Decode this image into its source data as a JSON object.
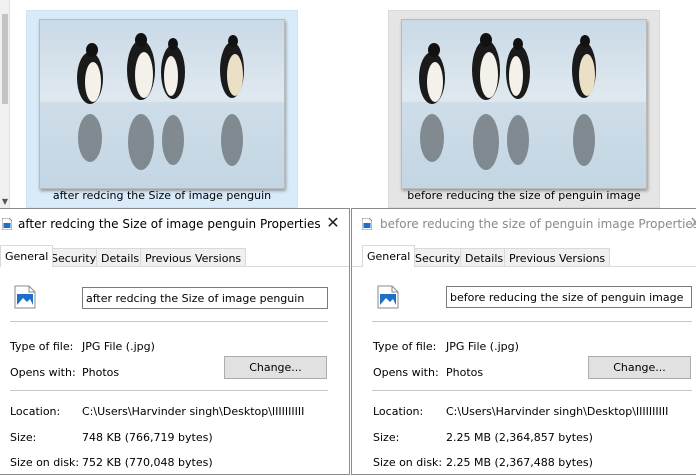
{
  "explorer": {
    "items": [
      {
        "caption": "after redcing the Size of image penguin"
      },
      {
        "caption": "before reducing the size of penguin image"
      }
    ]
  },
  "dialogs": [
    {
      "title": "after redcing the Size of image penguin Properties",
      "tabs": [
        "General",
        "Security",
        "Details",
        "Previous Versions"
      ],
      "file_name": "after redcing the Size of image penguin",
      "labels": {
        "type": "Type of file:",
        "opens": "Opens with:",
        "location": "Location:",
        "size": "Size:",
        "size_on_disk": "Size on disk:"
      },
      "type_of_file": "JPG File (.jpg)",
      "opens_with": "Photos",
      "change_label": "Change...",
      "location": "C:\\Users\\Harvinder singh\\Desktop\\IIIIIIIIII",
      "size": "748 KB (766,719 bytes)",
      "size_on_disk": "752 KB (770,048 bytes)"
    },
    {
      "title": "before reducing the size of penguin image Properties",
      "tabs": [
        "General",
        "Security",
        "Details",
        "Previous Versions"
      ],
      "file_name": "before reducing the size of penguin image",
      "labels": {
        "type": "Type of file:",
        "opens": "Opens with:",
        "location": "Location:",
        "size": "Size:",
        "size_on_disk": "Size on disk:"
      },
      "type_of_file": "JPG File (.jpg)",
      "opens_with": "Photos",
      "change_label": "Change...",
      "location": "C:\\Users\\Harvinder singh\\Desktop\\IIIIIIIIII",
      "size": "2.25 MB (2,364,857 bytes)",
      "size_on_disk": "2.25 MB (2,367,488 bytes)"
    }
  ],
  "icons": {
    "close": "close-icon",
    "file": "image-file-icon",
    "scroll": "chevron-down-icon"
  },
  "colors": {
    "selected_item_bg": "#d9ebf9",
    "hover_item_bg": "#e5e5e5",
    "button_bg": "#e1e1e1",
    "image_icon_blue": "#1e6fc8"
  }
}
